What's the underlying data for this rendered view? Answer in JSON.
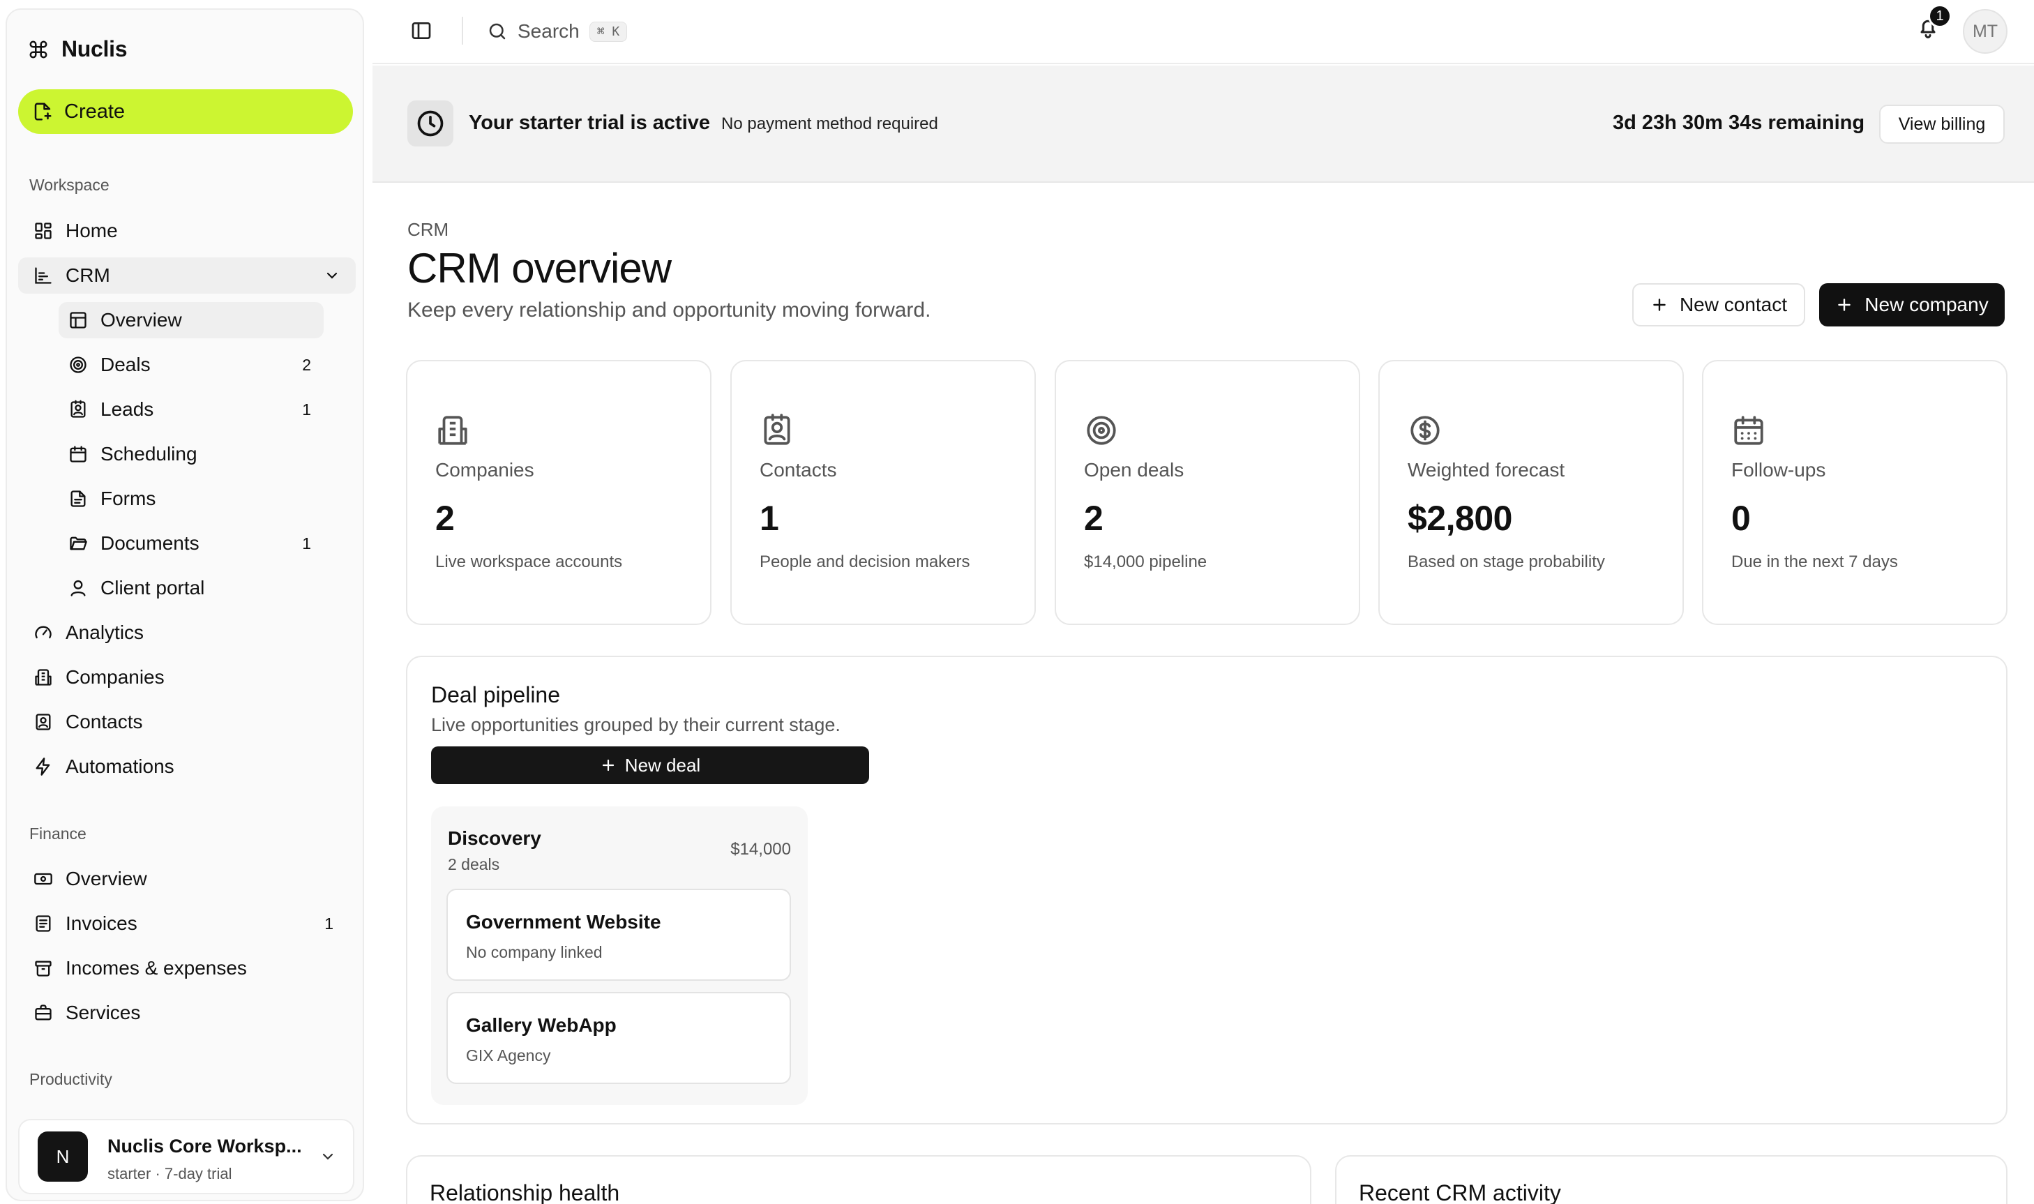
{
  "app": {
    "name": "Nuclis"
  },
  "sidebar": {
    "create_label": "Create",
    "workspace_label": "Workspace",
    "finance_label": "Finance",
    "productivity_label": "Productivity",
    "items": {
      "home": "Home",
      "crm": "CRM",
      "overview": "Overview",
      "deals": "Deals",
      "deals_count": "2",
      "leads": "Leads",
      "leads_count": "1",
      "scheduling": "Scheduling",
      "forms": "Forms",
      "documents": "Documents",
      "documents_count": "1",
      "client_portal": "Client portal",
      "analytics": "Analytics",
      "companies": "Companies",
      "contacts": "Contacts",
      "automations": "Automations",
      "finance_overview": "Overview",
      "invoices": "Invoices",
      "invoices_count": "1",
      "incomes": "Incomes & expenses",
      "services": "Services"
    },
    "workspace": {
      "initial": "N",
      "name": "Nuclis Core Worksp...",
      "plan": "starter · 7-day trial"
    }
  },
  "topbar": {
    "search_label": "Search",
    "search_shortcut": "⌘ K",
    "notification_count": "1",
    "user_initials": "MT"
  },
  "banner": {
    "title": "Your starter trial is active",
    "subtitle": "No payment method required",
    "remaining": "3d 23h 30m 34s remaining",
    "billing_button": "View billing"
  },
  "page": {
    "breadcrumb": "CRM",
    "title": "CRM overview",
    "subtitle": "Keep every relationship and opportunity moving forward.",
    "new_contact": "New contact",
    "new_company": "New company"
  },
  "stats": [
    {
      "label": "Companies",
      "value": "2",
      "desc": "Live workspace accounts",
      "icon": "building-icon"
    },
    {
      "label": "Contacts",
      "value": "1",
      "desc": "People and decision makers",
      "icon": "contact-book-icon"
    },
    {
      "label": "Open deals",
      "value": "2",
      "desc": "$14,000 pipeline",
      "icon": "target-icon"
    },
    {
      "label": "Weighted forecast",
      "value": "$2,800",
      "desc": "Based on stage probability",
      "icon": "dollar-circle-icon"
    },
    {
      "label": "Follow-ups",
      "value": "0",
      "desc": "Due in the next 7 days",
      "icon": "calendar-icon"
    }
  ],
  "pipeline": {
    "title": "Deal pipeline",
    "subtitle": "Live opportunities grouped by their current stage.",
    "new_deal": "New deal",
    "stage": {
      "name": "Discovery",
      "count": "2 deals",
      "total": "$14,000",
      "deals": [
        {
          "name": "Government Website",
          "company": "No company linked"
        },
        {
          "name": "Gallery WebApp",
          "company": "GIX Agency"
        }
      ]
    }
  },
  "sections": {
    "relationship_health": "Relationship health",
    "recent_activity": "Recent CRM activity"
  },
  "colors": {
    "accent": "#ccf531",
    "dark": "#111111",
    "muted": "#555555",
    "border": "#e7e7e7"
  }
}
